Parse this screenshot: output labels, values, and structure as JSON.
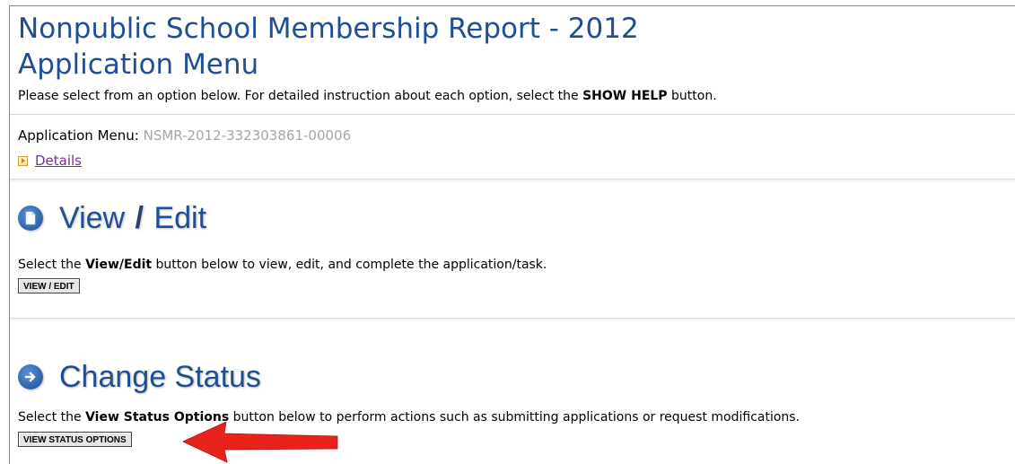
{
  "header": {
    "title": "Nonpublic School Membership Report - 2012",
    "subtitle": "Application Menu",
    "intro_prefix": "Please select from an option below. For detailed instruction about each option, select the ",
    "intro_bold": "SHOW HELP",
    "intro_suffix": " button."
  },
  "application": {
    "label": "Application Menu: ",
    "id": "NSMR-2012-332303861-00006",
    "details_link": "Details"
  },
  "view_edit": {
    "heading_view": "View",
    "heading_slash": "/",
    "heading_edit": "Edit",
    "text_prefix": "Select the ",
    "text_bold": "View/Edit",
    "text_suffix": " button below to view, edit, and complete the application/task.",
    "button_label": "VIEW / EDIT",
    "icon": "document-icon"
  },
  "change_status": {
    "heading": "Change Status",
    "text_prefix": "Select the ",
    "text_bold": "View Status Options",
    "text_suffix": " button below to perform actions such as submitting applications or request modifications.",
    "button_label": "VIEW STATUS OPTIONS",
    "icon": "arrow-right-icon"
  },
  "annotation": {
    "arrow_color": "#e8231c"
  },
  "colors": {
    "title": "#1f4e93",
    "link_visited": "#7a2b9a",
    "muted": "#a6a6a6"
  }
}
